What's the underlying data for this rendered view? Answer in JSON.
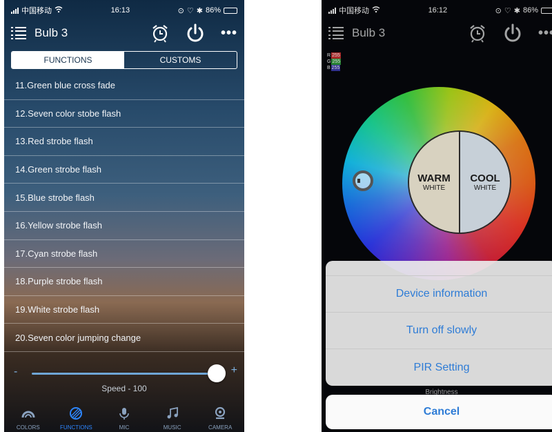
{
  "left": {
    "status": {
      "carrier": "中国移动",
      "time": "16:13",
      "battery": "86%"
    },
    "header": {
      "title": "Bulb 3",
      "more": "•••"
    },
    "segments": {
      "functions": "FUNCTIONS",
      "customs": "CUSTOMS",
      "active": "functions"
    },
    "functions": [
      "11.Green blue cross fade",
      "12.Seven color stobe flash",
      "13.Red strobe flash",
      "14.Green strobe flash",
      "15.Blue strobe flash",
      "16.Yellow strobe flash",
      "17.Cyan strobe flash",
      "18.Purple strobe flash",
      "19.White strobe flash",
      "20.Seven color jumping change"
    ],
    "speed": {
      "minus": "-",
      "plus": "+",
      "label": "Speed - 100",
      "value": 100,
      "max": 100
    },
    "tabs": [
      {
        "label": "COLORS",
        "icon": "colors-icon"
      },
      {
        "label": "FUNCTIONS",
        "icon": "functions-icon"
      },
      {
        "label": "MIC",
        "icon": "mic-icon"
      },
      {
        "label": "MUSIC",
        "icon": "music-icon"
      },
      {
        "label": "CAMERA",
        "icon": "camera-icon"
      }
    ],
    "active_tab": "FUNCTIONS"
  },
  "right": {
    "status": {
      "carrier": "中国移动",
      "time": "16:12",
      "battery": "86%"
    },
    "header": {
      "title": "Bulb 3",
      "more": "•••"
    },
    "rgb": {
      "r_label": "R",
      "r": "255",
      "g_label": "G",
      "g": "255",
      "b_label": "B",
      "b": "255"
    },
    "white": {
      "warm": "WARM",
      "warm_sub": "WHITE",
      "cool": "COOL",
      "cool_sub": "WHITE"
    },
    "hint": "Brightness",
    "sheet": {
      "items": [
        "Device information",
        "Turn off slowly",
        "PIR Setting"
      ],
      "cancel": "Cancel"
    }
  },
  "colors": {
    "accent": "#2e7cd6",
    "tab_active": "#2d86ff",
    "r": "#c83232",
    "g": "#2f9a3c",
    "b": "#3a3aa8"
  }
}
